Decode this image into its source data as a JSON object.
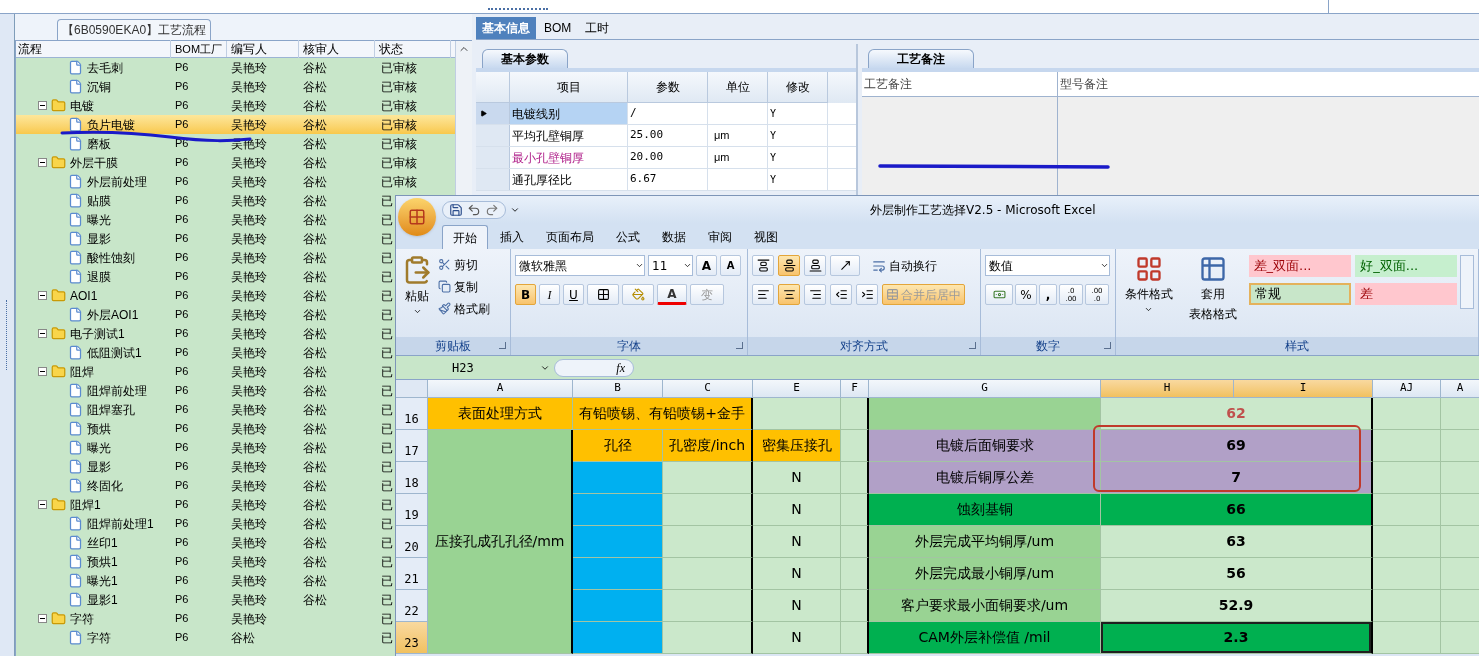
{
  "process_panel": {
    "title": "【6B0590EKA0】工艺流程",
    "columns": [
      "流程",
      "BOM工厂",
      "编写人",
      "核审人",
      "状态"
    ],
    "tree": [
      {
        "kind": "step",
        "name": "去毛刺",
        "factory": "P6",
        "writer": "吴艳玲",
        "reviewer": "谷松",
        "status": "已审核",
        "selected": false
      },
      {
        "kind": "step",
        "name": "沉铜",
        "factory": "P6",
        "writer": "吴艳玲",
        "reviewer": "谷松",
        "status": "已审核",
        "selected": false
      },
      {
        "kind": "folder",
        "name": "电镀",
        "factory": "P6",
        "writer": "吴艳玲",
        "reviewer": "谷松",
        "status": "已审核",
        "selected": false,
        "expanded": true,
        "children": [
          {
            "kind": "step",
            "name": "负片电镀",
            "factory": "P6",
            "writer": "吴艳玲",
            "reviewer": "谷松",
            "status": "已审核",
            "selected": true
          },
          {
            "kind": "step",
            "name": "磨板",
            "factory": "P6",
            "writer": "吴艳玲",
            "reviewer": "谷松",
            "status": "已审核",
            "selected": false
          }
        ]
      },
      {
        "kind": "folder",
        "name": "外层干膜",
        "factory": "P6",
        "writer": "吴艳玲",
        "reviewer": "谷松",
        "status": "已审核",
        "selected": false,
        "expanded": true,
        "children": [
          {
            "kind": "step",
            "name": "外层前处理",
            "factory": "P6",
            "writer": "吴艳玲",
            "reviewer": "谷松",
            "status": "已审核",
            "selected": false
          },
          {
            "kind": "step",
            "name": "贴膜",
            "factory": "P6",
            "writer": "吴艳玲",
            "reviewer": "谷松",
            "status": "已",
            "selected": false
          },
          {
            "kind": "step",
            "name": "曝光",
            "factory": "P6",
            "writer": "吴艳玲",
            "reviewer": "谷松",
            "status": "已",
            "selected": false
          },
          {
            "kind": "step",
            "name": "显影",
            "factory": "P6",
            "writer": "吴艳玲",
            "reviewer": "谷松",
            "status": "已",
            "selected": false
          },
          {
            "kind": "step",
            "name": "酸性蚀刻",
            "factory": "P6",
            "writer": "吴艳玲",
            "reviewer": "谷松",
            "status": "已",
            "selected": false
          },
          {
            "kind": "step",
            "name": "退膜",
            "factory": "P6",
            "writer": "吴艳玲",
            "reviewer": "谷松",
            "status": "已",
            "selected": false
          }
        ]
      },
      {
        "kind": "folder",
        "name": "AOI1",
        "factory": "P6",
        "writer": "吴艳玲",
        "reviewer": "谷松",
        "status": "已",
        "selected": false,
        "expanded": true,
        "children": [
          {
            "kind": "step",
            "name": "外层AOI1",
            "factory": "P6",
            "writer": "吴艳玲",
            "reviewer": "谷松",
            "status": "已",
            "selected": false
          }
        ]
      },
      {
        "kind": "folder",
        "name": "电子测试1",
        "factory": "P6",
        "writer": "吴艳玲",
        "reviewer": "谷松",
        "status": "已",
        "selected": false,
        "expanded": true,
        "children": [
          {
            "kind": "step",
            "name": "低阻测试1",
            "factory": "P6",
            "writer": "吴艳玲",
            "reviewer": "谷松",
            "status": "已",
            "selected": false
          }
        ]
      },
      {
        "kind": "folder",
        "name": "阻焊",
        "factory": "P6",
        "writer": "吴艳玲",
        "reviewer": "谷松",
        "status": "已",
        "selected": false,
        "expanded": true,
        "children": [
          {
            "kind": "step",
            "name": "阻焊前处理",
            "factory": "P6",
            "writer": "吴艳玲",
            "reviewer": "谷松",
            "status": "已",
            "selected": false
          },
          {
            "kind": "step",
            "name": "阻焊塞孔",
            "factory": "P6",
            "writer": "吴艳玲",
            "reviewer": "谷松",
            "status": "已",
            "selected": false
          },
          {
            "kind": "step",
            "name": "预烘",
            "factory": "P6",
            "writer": "吴艳玲",
            "reviewer": "谷松",
            "status": "已",
            "selected": false
          },
          {
            "kind": "step",
            "name": "曝光",
            "factory": "P6",
            "writer": "吴艳玲",
            "reviewer": "谷松",
            "status": "已",
            "selected": false
          },
          {
            "kind": "step",
            "name": "显影",
            "factory": "P6",
            "writer": "吴艳玲",
            "reviewer": "谷松",
            "status": "已",
            "selected": false
          },
          {
            "kind": "step",
            "name": "终固化",
            "factory": "P6",
            "writer": "吴艳玲",
            "reviewer": "谷松",
            "status": "已",
            "selected": false
          }
        ]
      },
      {
        "kind": "folder",
        "name": "阻焊1",
        "factory": "P6",
        "writer": "吴艳玲",
        "reviewer": "谷松",
        "status": "已",
        "selected": false,
        "expanded": true,
        "children": [
          {
            "kind": "step",
            "name": "阻焊前处理1",
            "factory": "P6",
            "writer": "吴艳玲",
            "reviewer": "谷松",
            "status": "已",
            "selected": false
          },
          {
            "kind": "step",
            "name": "丝印1",
            "factory": "P6",
            "writer": "吴艳玲",
            "reviewer": "谷松",
            "status": "已",
            "selected": false
          },
          {
            "kind": "step",
            "name": "预烘1",
            "factory": "P6",
            "writer": "吴艳玲",
            "reviewer": "谷松",
            "status": "已",
            "selected": false
          },
          {
            "kind": "step",
            "name": "曝光1",
            "factory": "P6",
            "writer": "吴艳玲",
            "reviewer": "谷松",
            "status": "已",
            "selected": false
          },
          {
            "kind": "step",
            "name": "显影1",
            "factory": "P6",
            "writer": "吴艳玲",
            "reviewer": "谷松",
            "status": "已",
            "selected": false
          }
        ]
      },
      {
        "kind": "folder",
        "name": "字符",
        "factory": "P6",
        "writer": "吴艳玲",
        "status": "已",
        "selected": false,
        "expanded": true,
        "children": [
          {
            "kind": "step",
            "name": "字符",
            "factory": "P6",
            "writer": "谷松",
            "status": "已",
            "selected": false
          }
        ]
      }
    ]
  },
  "info_panel": {
    "tabs": [
      {
        "label": "基本信息",
        "selected": true
      },
      {
        "label": "BOM",
        "selected": false
      },
      {
        "label": "工时",
        "selected": false
      }
    ],
    "params": {
      "tab": "基本参数",
      "columns": [
        "项目",
        "参数",
        "单位",
        "修改"
      ],
      "rows": [
        {
          "item": "电镀线别",
          "value": "/",
          "modify": "Y",
          "selected": true,
          "emphasis": false
        },
        {
          "item": "平均孔壁铜厚",
          "value": "25.00",
          "unit": "μm",
          "modify": "Y",
          "selected": false,
          "emphasis": false
        },
        {
          "item": "最小孔壁铜厚",
          "value": "20.00",
          "unit": "μm",
          "modify": "Y",
          "selected": false,
          "emphasis": true
        },
        {
          "item": "通孔厚径比",
          "value": "6.67",
          "modify": "Y",
          "selected": false,
          "emphasis": false
        }
      ]
    },
    "notes": {
      "tab": "工艺备注",
      "columns": [
        "工艺备注",
        "型号备注"
      ]
    }
  },
  "excel": {
    "title": "外层制作工艺选择V2.5 - Microsoft Excel",
    "tabs": [
      {
        "label": "开始",
        "selected": true
      },
      {
        "label": "插入",
        "selected": false
      },
      {
        "label": "页面布局",
        "selected": false
      },
      {
        "label": "公式",
        "selected": false
      },
      {
        "label": "数据",
        "selected": false
      },
      {
        "label": "审阅",
        "selected": false
      },
      {
        "label": "视图",
        "selected": false
      }
    ],
    "clipboard": {
      "paste": "粘贴",
      "cut": "剪切",
      "copy": "复制",
      "format_painter": "格式刷",
      "group": "剪贴板"
    },
    "font": {
      "family": "微软雅黑",
      "size": "11",
      "grow": "A",
      "shrink": "A",
      "bold": {
        "label": "B",
        "on": true
      },
      "italic": {
        "label": "I",
        "on": false
      },
      "underline": {
        "label": "U",
        "on": false
      },
      "font_color": "A",
      "phonetic": "变",
      "group": "字体"
    },
    "alignment": {
      "valign": [
        {
          "on": false
        },
        {
          "on": true
        },
        {
          "on": false
        }
      ],
      "halign": [
        {
          "on": false
        },
        {
          "on": true
        },
        {
          "on": false
        }
      ],
      "wrap": "自动换行",
      "merge": {
        "label": "合并后居中",
        "on": true
      },
      "group": "对齐方式"
    },
    "number": {
      "format": "数值",
      "percent": "%",
      "comma": ",",
      "decimals": [
        {
          "top": ".0",
          "bottom": ".00"
        },
        {
          "top": ".00",
          "bottom": ".0"
        }
      ],
      "group": "数字"
    },
    "styles": {
      "conditional": "条件格式",
      "table_format": [
        "套用",
        "表格格式"
      ],
      "cells": [
        {
          "label": "差_双面...",
          "kind": "bad",
          "selected": false
        },
        {
          "label": "好_双面...",
          "kind": "good",
          "selected": false
        },
        {
          "label": "常规",
          "kind": "normal",
          "selected": true
        },
        {
          "label": "差",
          "kind": "bad",
          "selected": false
        }
      ],
      "group": "样式"
    },
    "name_box": "H23",
    "formula_label": "fx",
    "sheet": {
      "columns": [
        {
          "label": "A",
          "selected": false
        },
        {
          "label": "B",
          "selected": false
        },
        {
          "label": "C",
          "selected": false
        },
        {
          "label": "E",
          "selected": false
        },
        {
          "label": "F",
          "selected": false
        },
        {
          "label": "G",
          "selected": false
        },
        {
          "label": "H",
          "selected": true
        },
        {
          "label": "I",
          "selected": true
        },
        {
          "label": "AJ",
          "selected": false
        },
        {
          "label": "A",
          "selected": false
        }
      ],
      "side_label": "压接孔成孔孔径/mm",
      "rows": [
        {
          "number": "16",
          "selected": false,
          "a": {
            "text": "表面处理方式",
            "kind": "header"
          },
          "bc": {
            "text": "有铅喷锡、有铅喷锡+金手",
            "kind": "header"
          },
          "e": {
            "kind": "blank"
          },
          "g": {
            "kind": "label"
          },
          "h": {
            "text": "62",
            "kind": "note"
          }
        },
        {
          "number": "17",
          "selected": false,
          "b": {
            "text": "孔径",
            "kind": "header"
          },
          "c": {
            "text": "孔密度/inch",
            "kind": "header"
          },
          "e": {
            "text": "密集压接孔",
            "kind": "header"
          },
          "g": {
            "text": "电镀后面铜要求",
            "kind": "check"
          },
          "h": {
            "text": "69",
            "kind": "check"
          }
        },
        {
          "number": "18",
          "selected": false,
          "b": {
            "kind": "input"
          },
          "c": {
            "kind": "blank"
          },
          "e": {
            "text": "N",
            "kind": "blank"
          },
          "g": {
            "text": "电镀后铜厚公差",
            "kind": "check"
          },
          "h": {
            "text": "7",
            "kind": "check"
          }
        },
        {
          "number": "19",
          "selected": false,
          "b": {
            "kind": "input"
          },
          "c": {
            "kind": "blank"
          },
          "e": {
            "text": "N",
            "kind": "blank"
          },
          "g": {
            "text": "蚀刻基铜",
            "kind": "key"
          },
          "h": {
            "text": "66",
            "kind": "key"
          }
        },
        {
          "number": "20",
          "selected": false,
          "b": {
            "kind": "input"
          },
          "c": {
            "kind": "blank"
          },
          "e": {
            "text": "N",
            "kind": "blank"
          },
          "g": {
            "text": "外层完成平均铜厚/um",
            "kind": "label"
          },
          "h": {
            "text": "63",
            "kind": "blank"
          }
        },
        {
          "number": "21",
          "selected": false,
          "b": {
            "kind": "input"
          },
          "c": {
            "kind": "blank"
          },
          "e": {
            "text": "N",
            "kind": "blank"
          },
          "g": {
            "text": "外层完成最小铜厚/um",
            "kind": "label"
          },
          "h": {
            "text": "56",
            "kind": "blank"
          }
        },
        {
          "number": "22",
          "selected": false,
          "b": {
            "kind": "input"
          },
          "c": {
            "kind": "blank"
          },
          "e": {
            "text": "N",
            "kind": "blank"
          },
          "g": {
            "text": "客户要求最小面铜要求/um",
            "kind": "label"
          },
          "h": {
            "text": "52.9",
            "kind": "blank"
          }
        },
        {
          "number": "23",
          "selected": true,
          "b": {
            "kind": "input"
          },
          "c": {
            "kind": "blank"
          },
          "e": {
            "text": "N",
            "kind": "blank"
          },
          "g": {
            "text": "CAM外层补偿值 /mil",
            "kind": "key"
          },
          "h": {
            "text": "2.3",
            "kind": "key"
          }
        }
      ]
    }
  }
}
